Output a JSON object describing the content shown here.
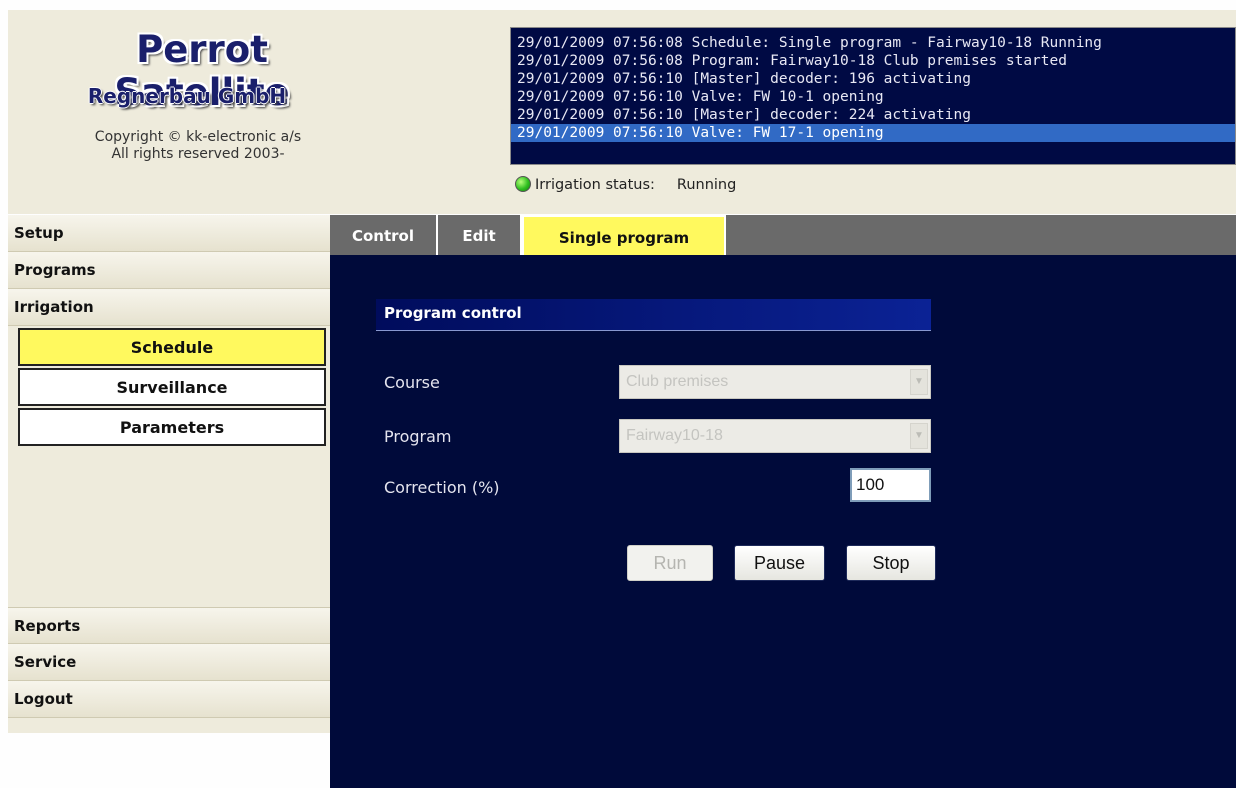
{
  "header": {
    "logo_title": "Perrot Satellite",
    "logo_subtitle": "Regnerbau GmbH",
    "copyright_line1": "Copyright © kk-electronic a/s",
    "copyright_line2": "All rights reserved 2003-"
  },
  "log": {
    "lines": [
      "29/01/2009 07:56:08 Schedule: Single program - Fairway10-18 Running",
      "29/01/2009 07:56:08 Program: Fairway10-18 Club premises started",
      "29/01/2009 07:56:10 [Master] decoder: 196 activating",
      "29/01/2009 07:56:10 Valve: FW 10-1 opening",
      "29/01/2009 07:56:10 [Master] decoder: 224 activating",
      "29/01/2009 07:56:10 Valve: FW 17-1 opening"
    ]
  },
  "status": {
    "label": "Irrigation status:",
    "value": "Running",
    "indicator_color": "#2fbf20"
  },
  "sidebar": {
    "top_items": [
      "Setup",
      "Programs",
      "Irrigation"
    ],
    "sub_items": [
      "Schedule",
      "Surveillance",
      "Parameters"
    ],
    "bottom_items": [
      "Reports",
      "Service",
      "Logout"
    ]
  },
  "tabs": [
    "Control",
    "Edit",
    "Single program"
  ],
  "program_control": {
    "section_title": "Program control",
    "course_label": "Course",
    "course_value": "Club premises",
    "program_label": "Program",
    "program_value": "Fairway10-18",
    "correction_label": "Correction (%)",
    "correction_value": "100",
    "run_label": "Run",
    "pause_label": "Pause",
    "stop_label": "Stop"
  },
  "colors": {
    "active_yellow": "#fff95e",
    "main_background": "#000a3a",
    "log_background": "#000a44",
    "log_selected": "#316ac5"
  }
}
